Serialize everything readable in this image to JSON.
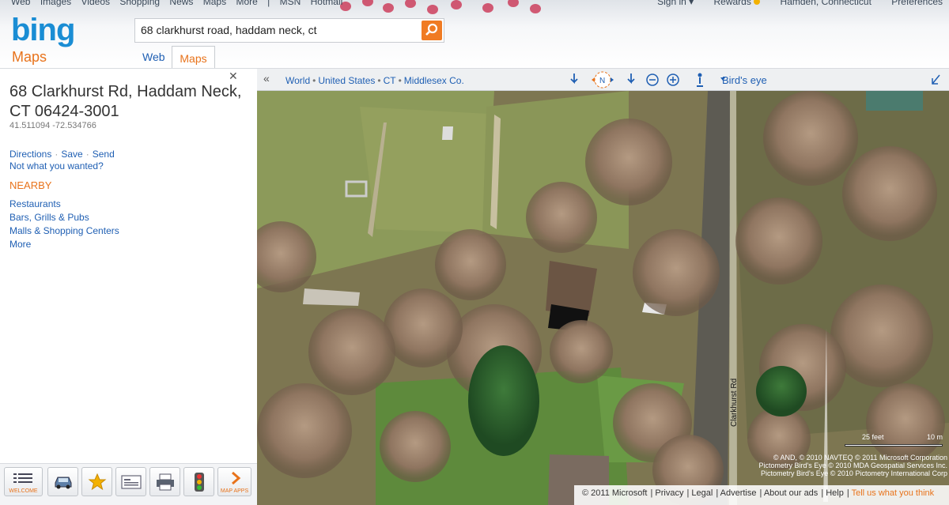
{
  "topnav": {
    "left_links": [
      "Web",
      "Images",
      "Videos",
      "Shopping",
      "News",
      "Maps",
      "More",
      "|",
      "MSN",
      "Hotmail"
    ],
    "sign_in": "Sign in ▾",
    "rewards": "Rewards",
    "location": "Hamden, Connecticut",
    "preferences": "Preferences"
  },
  "brand": {
    "logo": "bing",
    "product": "Maps"
  },
  "search": {
    "value": "68 clarkhurst road, haddam neck, ct"
  },
  "tabs": {
    "web": "Web",
    "maps": "Maps"
  },
  "result": {
    "address_line1": "68 Clarkhurst Rd, Haddam Neck,",
    "address_line2": "CT 06424-3001",
    "coords": "41.511094 -72.534766",
    "actions": [
      "Directions",
      "Save",
      "Send"
    ],
    "not_wanted": "Not what you wanted?",
    "nearby_title": "NEARBY",
    "nearby": [
      "Restaurants",
      "Bars, Grills & Pubs",
      "Malls & Shopping Centers",
      "More"
    ]
  },
  "tools": {
    "welcome": "WELCOME",
    "map_apps": "MAP APPS"
  },
  "mapbar": {
    "collapse": "«",
    "breadcrumb": [
      "World",
      "United States",
      "CT",
      "Middlesex Co."
    ],
    "view": "Bird's eye"
  },
  "map": {
    "road_label": "Clarkhurst Rd",
    "scale_feet": "25 feet",
    "scale_m": "10 m",
    "copyright_1": "© AND, © 2010 NAVTEQ  © 2011 Microsoft Corporation",
    "copyright_2": "Pictometry Bird's Eye © 2010 MDA Geospatial Services Inc.",
    "copyright_3": "Pictometry Bird's Eye © 2010 Pictometry International Corp"
  },
  "footer": [
    "© 2011 Microsoft",
    "Privacy",
    "Legal",
    "Advertise",
    "About our ads",
    "Help",
    "Tell us what you think"
  ],
  "colors": {
    "accent": "#e8731b",
    "link": "#1f5fb3",
    "logo": "#1a8dd4"
  }
}
